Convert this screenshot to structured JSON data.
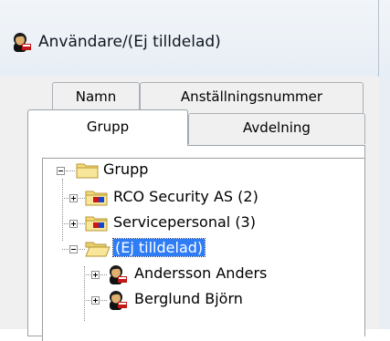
{
  "window": {
    "title": "Användare/(Ej tilldelad)",
    "icon": "user-icon"
  },
  "tabs": {
    "row1": [
      "Namn",
      "Anställningsnummer"
    ],
    "row2": [
      "Grupp",
      "Avdelning"
    ],
    "active": "Grupp"
  },
  "tree": {
    "root": {
      "label": "Grupp",
      "icon": "folder-icon",
      "expanded": true
    },
    "children": [
      {
        "label": "RCO Security AS (2)",
        "icon": "group-folder-icon",
        "expanded": false
      },
      {
        "label": "Servicepersonal (3)",
        "icon": "group-folder-icon",
        "expanded": false
      },
      {
        "label": "(Ej tilldelad)",
        "icon": "open-folder-icon",
        "expanded": true,
        "selected": true
      }
    ],
    "users": [
      {
        "label": "Andersson Anders",
        "icon": "user-icon"
      },
      {
        "label": "Berglund Björn",
        "icon": "user-icon"
      }
    ]
  },
  "colors": {
    "selection": "#2f7df6",
    "selection_text": "#ffffff",
    "titlebar": "#f1f5f9",
    "panel": "#f0f0f0"
  }
}
